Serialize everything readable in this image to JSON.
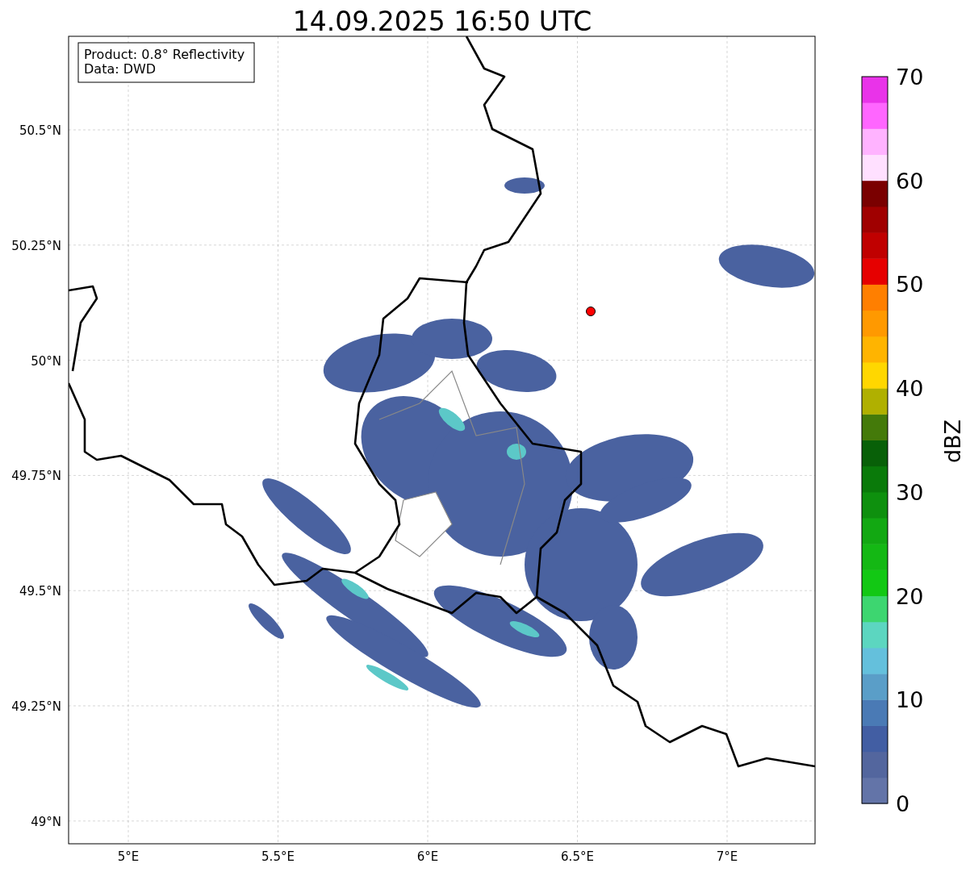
{
  "title": "14.09.2025 16:50 UTC",
  "info_box": [
    "Product: 0.8° Reflectivity",
    "Data: DWD"
  ],
  "y_ticks": [
    "50.5°N",
    "50.25°N",
    "50°N",
    "49.75°N",
    "49.5°N",
    "49.25°N",
    "49°N"
  ],
  "x_ticks": [
    "5°E",
    "5.5°E",
    "6°E",
    "6.5°E",
    "7°E"
  ],
  "colorbar": {
    "label": "dBZ",
    "ticks": [
      "70",
      "60",
      "50",
      "40",
      "30",
      "20",
      "10",
      "0"
    ],
    "bands": [
      {
        "color": "#6374a8"
      },
      {
        "color": "#53669e"
      },
      {
        "color": "#425ea3"
      },
      {
        "color": "#4a7ab5"
      },
      {
        "color": "#5a9ec8"
      },
      {
        "color": "#64c0dc"
      },
      {
        "color": "#5cd6c0"
      },
      {
        "color": "#3dd670"
      },
      {
        "color": "#12c814"
      },
      {
        "color": "#14b814"
      },
      {
        "color": "#12a812"
      },
      {
        "color": "#0e900e"
      },
      {
        "color": "#0a7a0a"
      },
      {
        "color": "#086008"
      },
      {
        "color": "#447a0a"
      },
      {
        "color": "#b0b000"
      },
      {
        "color": "#ffd700"
      },
      {
        "color": "#ffb400"
      },
      {
        "color": "#ff9900"
      },
      {
        "color": "#ff7f00"
      },
      {
        "color": "#e60000"
      },
      {
        "color": "#c00000"
      },
      {
        "color": "#a00000"
      },
      {
        "color": "#7a0000"
      },
      {
        "color": "#ffe0ff"
      },
      {
        "color": "#ffb3ff"
      },
      {
        "color": "#ff66ff"
      },
      {
        "color": "#e933e9"
      }
    ]
  }
}
